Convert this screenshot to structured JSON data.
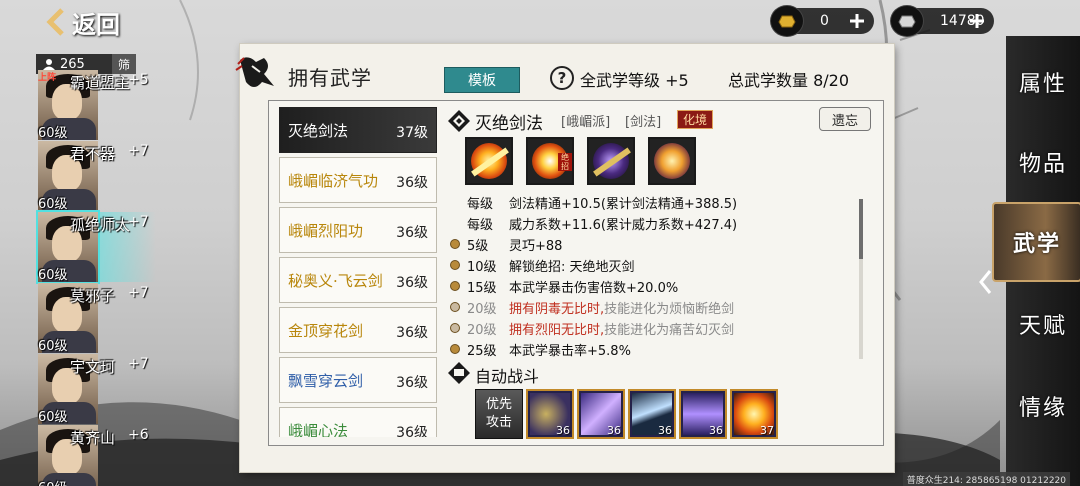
{
  "nav": {
    "back_label": "返回"
  },
  "currency": {
    "gold": {
      "icon": "gold-ingot-icon",
      "value": "0"
    },
    "silver": {
      "icon": "silver-ingot-icon",
      "value": "14780"
    }
  },
  "characters": {
    "count": "265",
    "filter_label": "筛",
    "items": [
      {
        "tag": "上阵",
        "name": "霸道盟主",
        "bonus": "+5",
        "level": "60级",
        "selected": false
      },
      {
        "tag": "",
        "name": "君不器",
        "bonus": "+7",
        "level": "60级",
        "selected": false
      },
      {
        "tag": "",
        "name": "孤绝师太",
        "bonus": "+7",
        "level": "60级",
        "selected": true
      },
      {
        "tag": "",
        "name": "莫邪子",
        "bonus": "+7",
        "level": "60级",
        "selected": false
      },
      {
        "tag": "",
        "name": "宇文珂",
        "bonus": "+7",
        "level": "60级",
        "selected": false
      },
      {
        "tag": "",
        "name": "黄齐山",
        "bonus": "+6",
        "level": "60级",
        "selected": false
      }
    ]
  },
  "side_nav": [
    {
      "label": "属性",
      "active": false
    },
    {
      "label": "物品",
      "active": false
    },
    {
      "label": "武学",
      "active": true
    },
    {
      "label": "天赋",
      "active": false
    },
    {
      "label": "情缘",
      "active": false
    }
  ],
  "panel": {
    "title": "拥有武学",
    "template_label": "模板",
    "all_level_text": "全武学等级 +5",
    "count_text": "总武学数量 8/20"
  },
  "skills": [
    {
      "name": "灭绝剑法",
      "level": "37级",
      "color": "#ffffff",
      "selected": true
    },
    {
      "name": "峨嵋临济气功",
      "level": "36级",
      "color": "#b8860b",
      "selected": false
    },
    {
      "name": "峨嵋烈阳功",
      "level": "36级",
      "color": "#b8860b",
      "selected": false
    },
    {
      "name": "秘奥义·飞云剑",
      "level": "36级",
      "color": "#b8860b",
      "selected": false
    },
    {
      "name": "金顶穿花剑",
      "level": "36级",
      "color": "#b8860b",
      "selected": false
    },
    {
      "name": "飘雪穿云剑",
      "level": "36级",
      "color": "#2f5ea8",
      "selected": false
    },
    {
      "name": "峨嵋心法",
      "level": "36级",
      "color": "#3c8c3c",
      "selected": false
    }
  ],
  "detail": {
    "name": "灭绝剑法",
    "sect": "[峨嵋派]",
    "type": "[剑法]",
    "badge": "化境",
    "legacy_label": "遗忘",
    "move_mark": "绝招",
    "effects": [
      {
        "level": "每级",
        "text": "剑法精通+10.5(累计剑法精通+388.5)",
        "dot": false,
        "disabled": false
      },
      {
        "level": "每级",
        "text": "威力系数+11.6(累计威力系数+427.4)",
        "dot": false,
        "disabled": false
      },
      {
        "level": "5级",
        "text": "灵巧+88",
        "dot": true,
        "disabled": false
      },
      {
        "level": "10级",
        "text": "解锁绝招:   天绝地灭剑",
        "dot": true,
        "disabled": false
      },
      {
        "level": "15级",
        "text": "本武学暴击伤害倍数+20.0%",
        "dot": true,
        "disabled": false
      },
      {
        "level": "20级",
        "red": "拥有阴毒无比时,",
        "text": "技能进化为烦恼断绝剑",
        "dot": true,
        "disabled": true
      },
      {
        "level": "20级",
        "red": "拥有烈阳无比时,",
        "text": "技能进化为痛苦幻灭剑",
        "dot": true,
        "disabled": true
      },
      {
        "level": "25级",
        "text": "本武学暴击率+5.8%",
        "dot": true,
        "disabled": false
      }
    ]
  },
  "auto_battle": {
    "title": "自动战斗",
    "priority_line1": "优先",
    "priority_line2": "攻击",
    "slots": [
      "36",
      "36",
      "36",
      "36",
      "37"
    ]
  },
  "footer": {
    "id_text": "普度众生214: 285865198  01212220"
  }
}
